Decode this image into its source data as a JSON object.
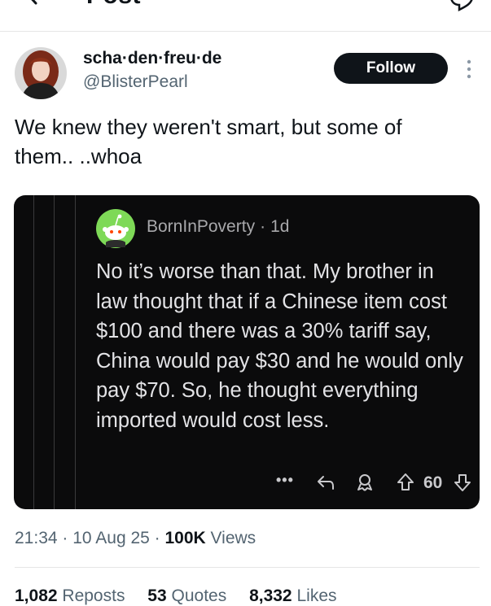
{
  "topbar": {
    "title": "Post"
  },
  "author": {
    "display_name": "scha·den·freu·de",
    "handle": "@BlisterPearl",
    "follow_label": "Follow"
  },
  "tweet": {
    "text": "We knew they weren't smart, but some of\nthem..  ..whoa"
  },
  "embedded_comment": {
    "username": "BornInPoverty",
    "separator": "·",
    "age": "1d",
    "body": "No it’s worse than that. My brother in law thought that if a Chinese item cost $100 and there was a 30% tariff say, China would pay $30 and he would only pay $70. So, he thought everything imported would cost less.",
    "more_label": "•••",
    "vote_count": "60"
  },
  "meta": {
    "time": "21:34",
    "sep1": " · ",
    "date": "10 Aug 25",
    "sep2": " · ",
    "views_count": "100K",
    "views_label": " Views"
  },
  "stats": {
    "reposts_count": "1,082",
    "reposts_label": "Reposts",
    "quotes_count": "53",
    "quotes_label": "Quotes",
    "likes_count": "8,332",
    "likes_label": "Likes"
  },
  "colors": {
    "follow_bg": "#0f1419",
    "card_bg": "#0b0b0c",
    "secondary_text": "#536471",
    "snoo_green": "#7ed957"
  }
}
